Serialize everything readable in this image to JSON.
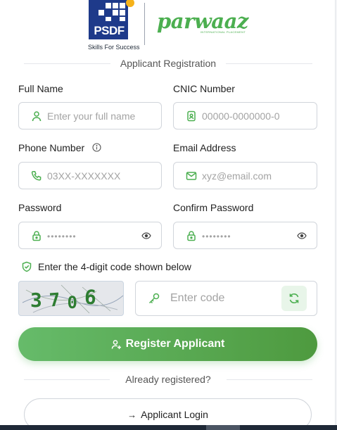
{
  "logos": {
    "psdf_text": "PSDF",
    "psdf_tagline": "Skills For Success",
    "parwaaz_text": "parwaaz",
    "parwaaz_sub": "INTERNATIONAL PLACEMENT"
  },
  "section_title": "Applicant Registration",
  "fields": {
    "full_name": {
      "label": "Full Name",
      "placeholder": "Enter your full name",
      "icon": "user-icon"
    },
    "cnic": {
      "label": "CNIC Number",
      "placeholder": "00000-0000000-0",
      "icon": "id-card-icon"
    },
    "phone": {
      "label": "Phone Number",
      "placeholder": "03XX-XXXXXXX",
      "icon": "phone-icon",
      "info_icon": "info-icon"
    },
    "email": {
      "label": "Email Address",
      "placeholder": "xyz@email.com",
      "icon": "envelope-icon"
    },
    "password": {
      "label": "Password",
      "placeholder": "••••••••",
      "icon": "lock-icon",
      "toggle_icon": "eye-icon"
    },
    "confirm_password": {
      "label": "Confirm Password",
      "placeholder": "••••••••",
      "icon": "lock-icon",
      "toggle_icon": "eye-icon"
    }
  },
  "captcha": {
    "instruction": "Enter the 4-digit code shown below",
    "digits": [
      "3",
      "7",
      "0",
      "6"
    ],
    "code_placeholder": "Enter code",
    "icon": "shield-icon",
    "key_icon": "key-icon",
    "refresh_icon": "refresh-icon"
  },
  "actions": {
    "register_label": "Register Applicant",
    "already_registered": "Already registered?",
    "login_label": "Applicant Login",
    "login_arrow": "→"
  },
  "colors": {
    "brand_green": "#4caf50",
    "psdf_blue": "#1e3a8a",
    "accent_yellow": "#f6b21a"
  }
}
